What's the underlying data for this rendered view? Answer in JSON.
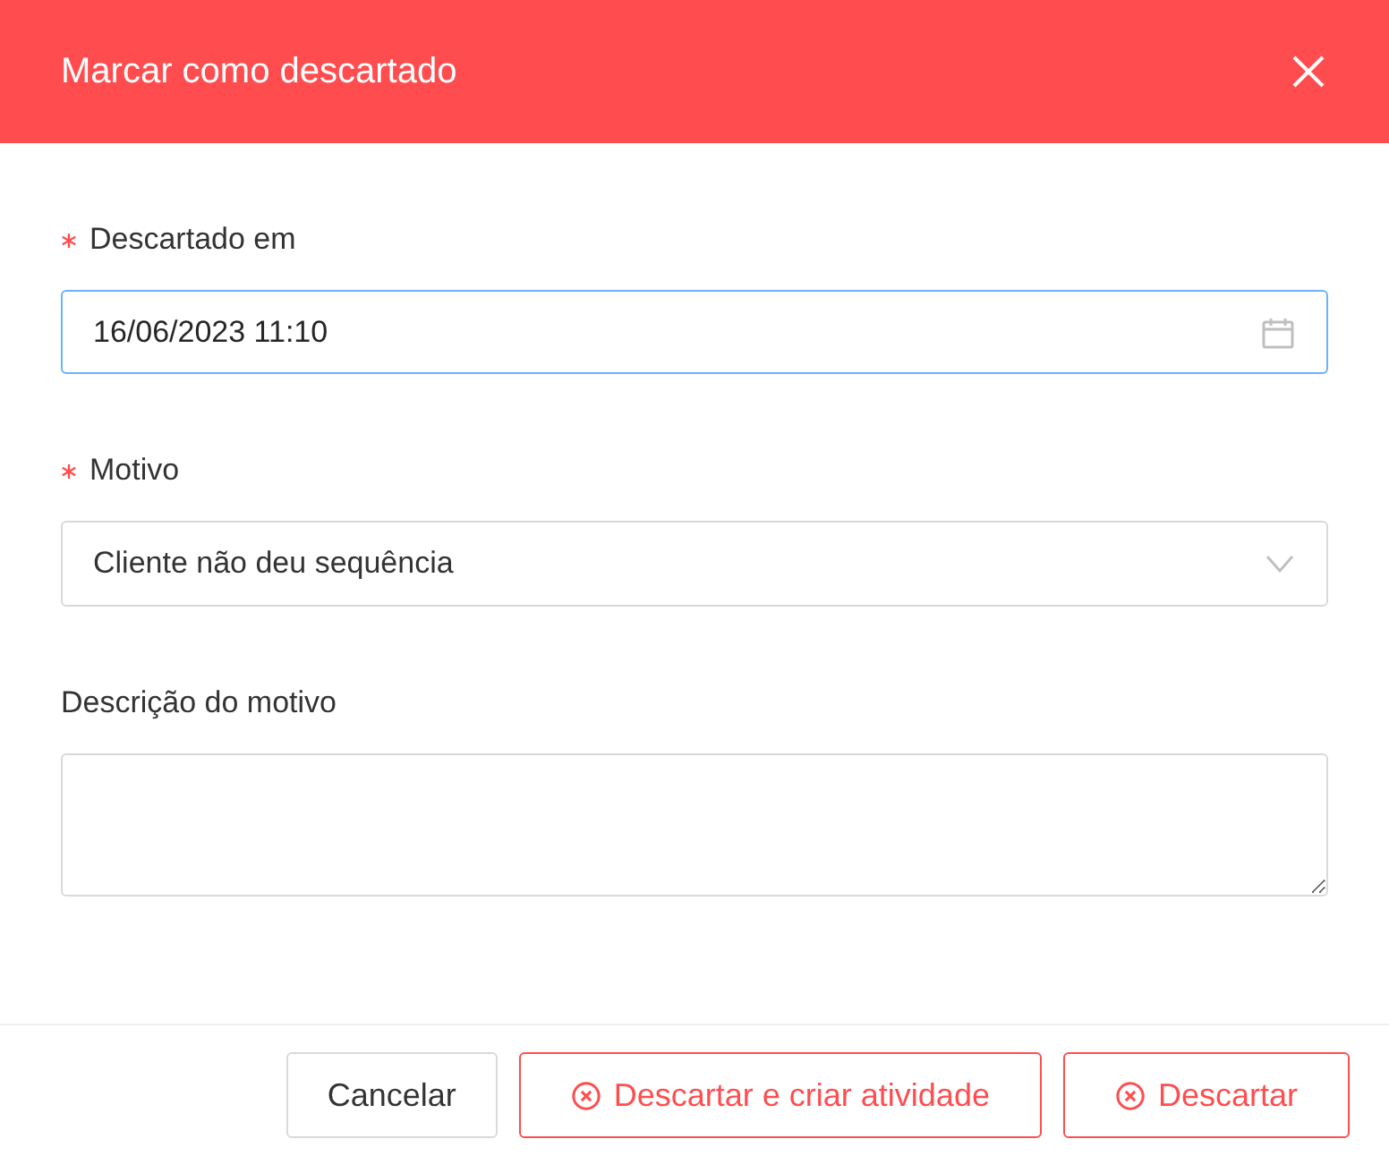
{
  "dialog": {
    "title": "Marcar como descartado"
  },
  "fields": [
    {
      "kind": "date",
      "label": "Descartado em",
      "required": true,
      "focused": true,
      "value": "16/06/2023 11:10"
    },
    {
      "kind": "select",
      "label": "Motivo",
      "required": true,
      "focused": false,
      "value": "Cliente não deu sequência"
    },
    {
      "kind": "textarea",
      "label": "Descrição do motivo",
      "required": false,
      "focused": false
    }
  ],
  "buttons": [
    {
      "kind": "default",
      "label": "Cancelar"
    },
    {
      "kind": "danger",
      "label": "Descartar e criar atividade"
    },
    {
      "kind": "danger",
      "label": "Descartar"
    }
  ]
}
